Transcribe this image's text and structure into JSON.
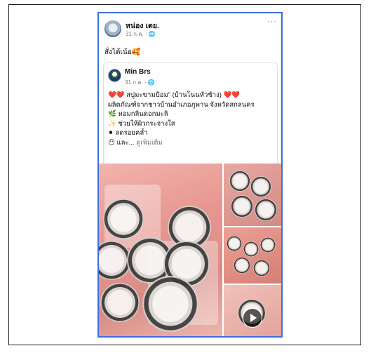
{
  "post": {
    "author": "หน่อง เตย.",
    "meta": "31 ก.ค. · 🌐",
    "more": "···",
    "caption": "สั่งได้เน้อ🥰"
  },
  "shared": {
    "author": "Min Brs",
    "meta": "31 ก.ค. · 🌐",
    "lines": [
      "❤️❤️ สบู่มะขามป้อม\" (บ้านโนนหัวช้าง) ❤️❤️",
      "ผลิตภัณฑ์จากชาวบ้านอำเภอภูพาน จังหวัดสกลนคร",
      "🌿 หอมกลิ่นดอกมะลิ",
      "✨ ช่วยให้ผิวกระจ่างใส",
      "⚫ ลดรอยคล้ำ"
    ],
    "last_line_prefix": "😶 และ...",
    "see_more": "ดูเพิ่มเติม"
  },
  "photos": {
    "main_label": "product-photo-soap-packs",
    "video_icon": "play-icon"
  }
}
